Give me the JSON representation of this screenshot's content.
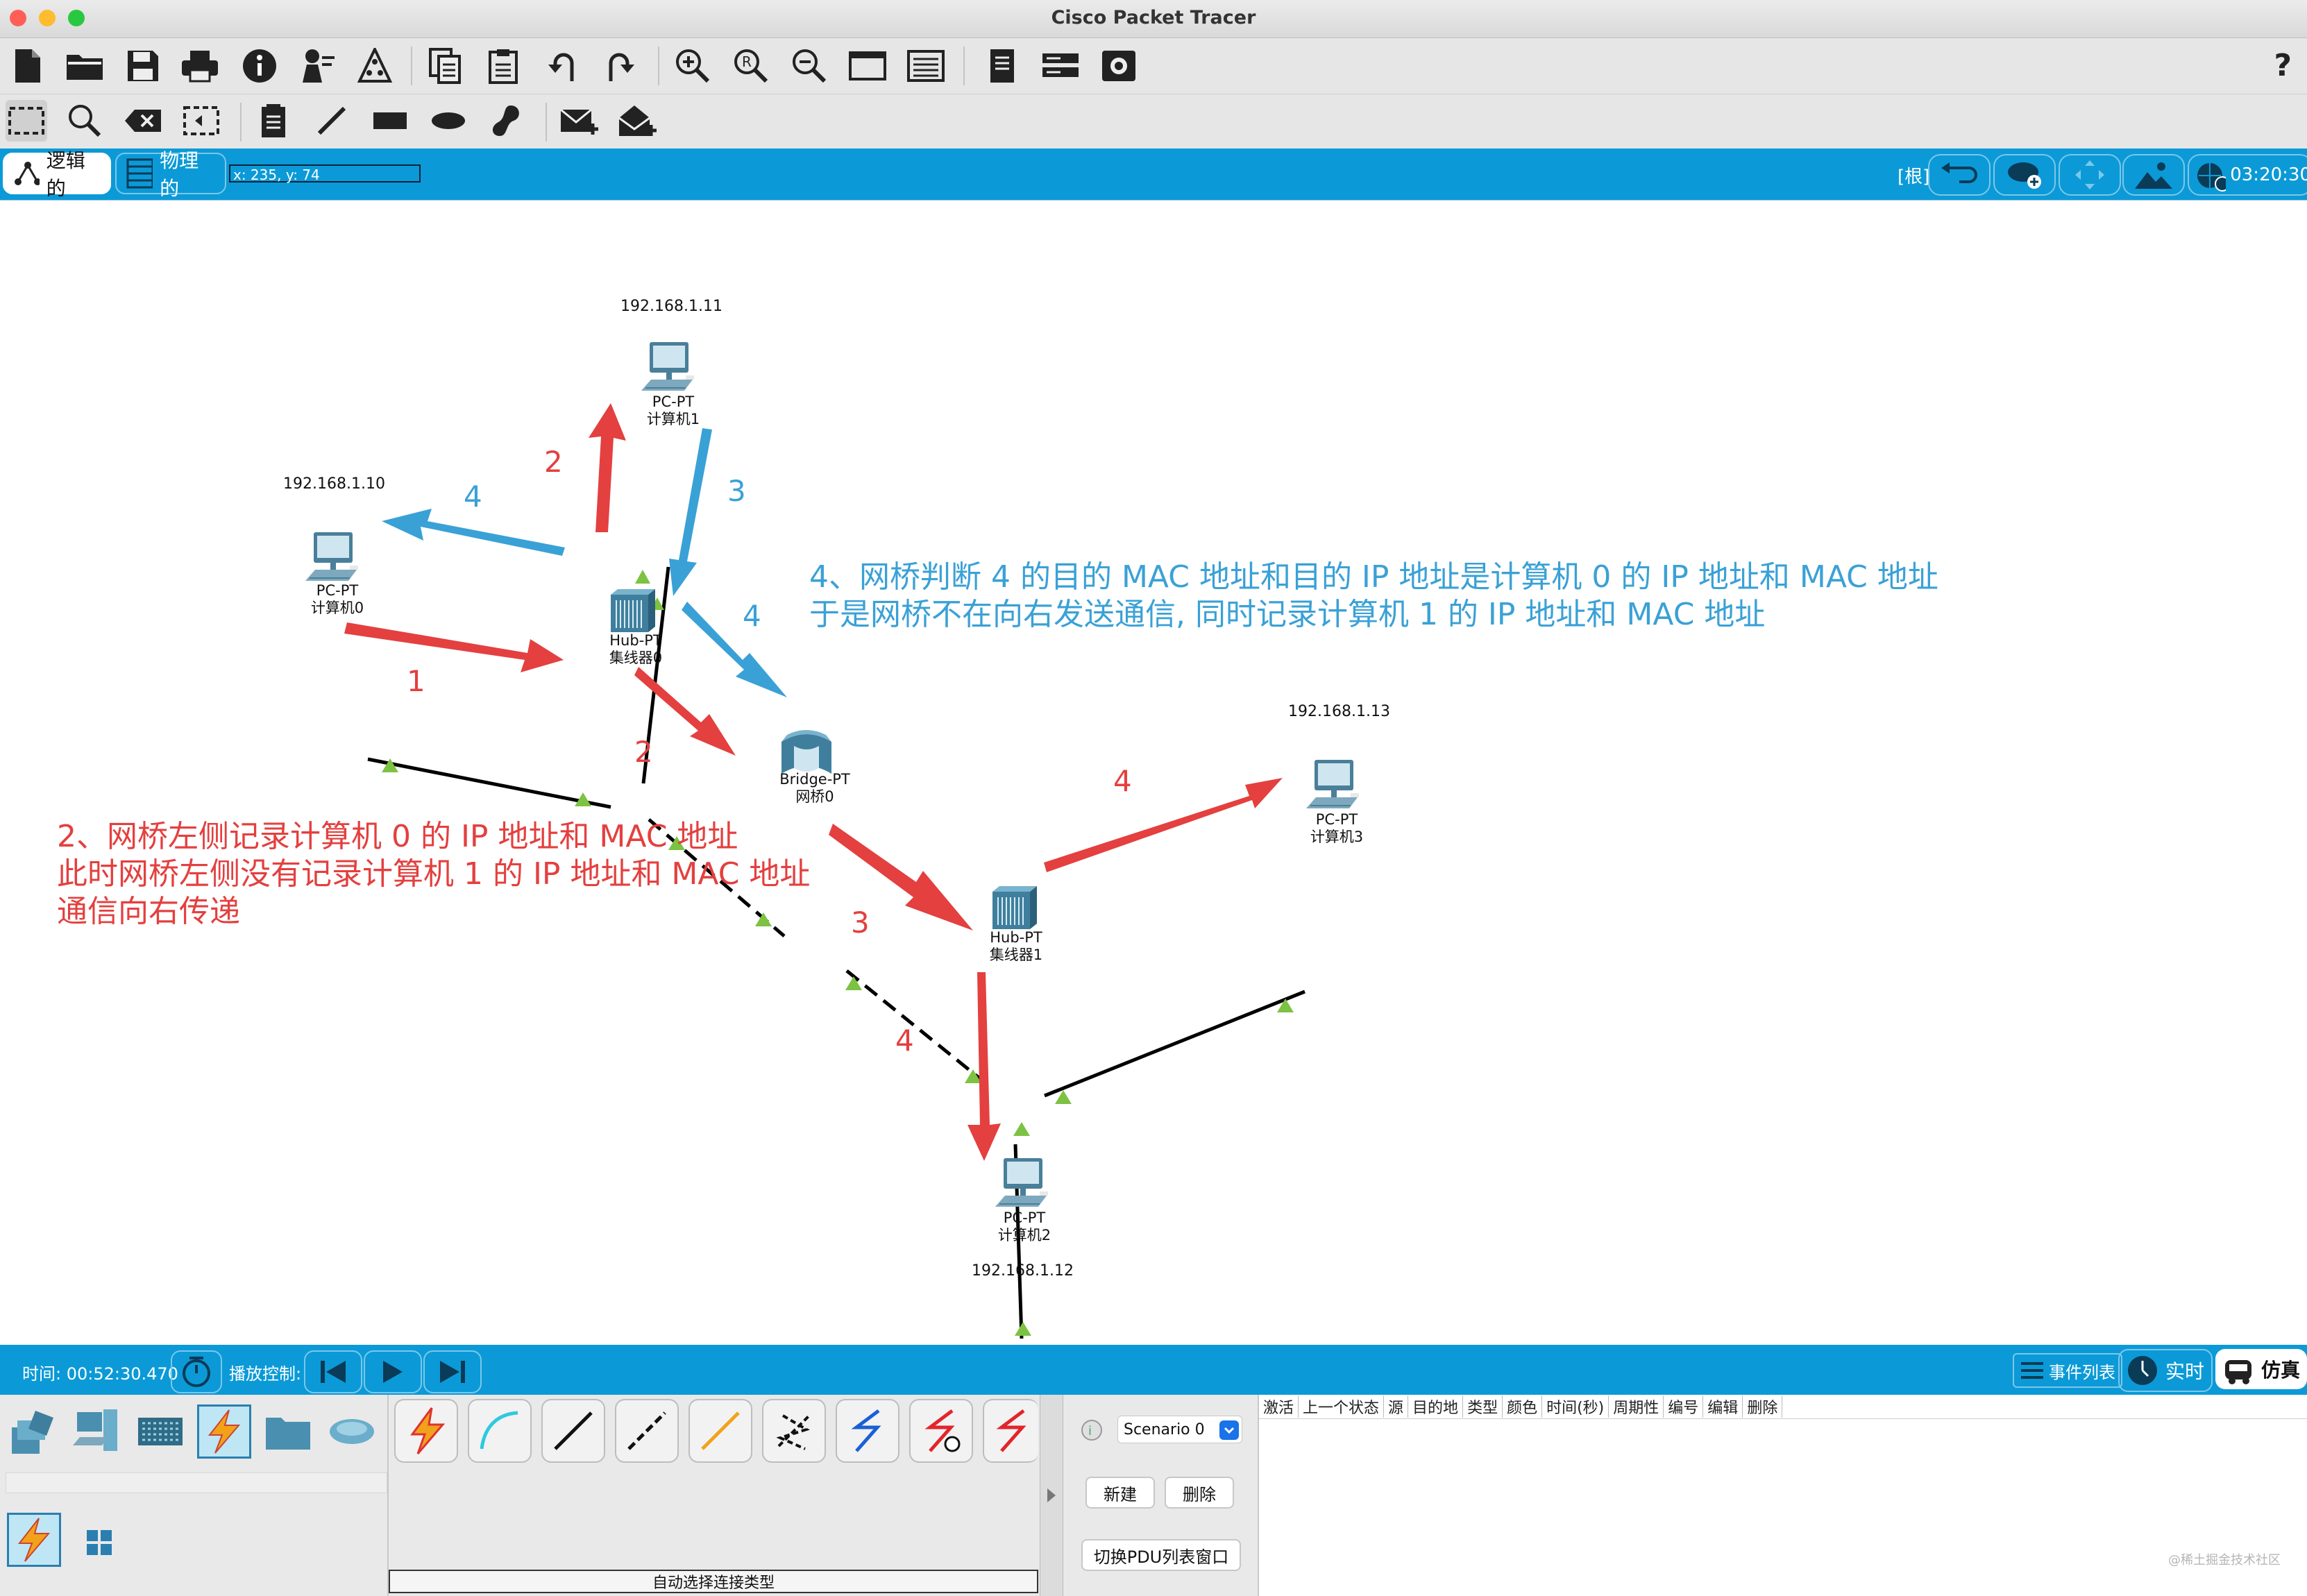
{
  "window": {
    "title": "Cisco Packet Tracer"
  },
  "toolbar_main": {
    "icons": [
      "new-file",
      "open-folder",
      "save",
      "print",
      "info",
      "activity-wizard",
      "network-info",
      "copy",
      "paste",
      "undo",
      "redo",
      "zoom-in",
      "zoom-reset",
      "zoom-out",
      "drawing-palette",
      "custom-device-dialog",
      "pdu-list",
      "cluster",
      "user-profile"
    ],
    "help": "?"
  },
  "toolbar_edit": {
    "icons": [
      "select",
      "inspect",
      "delete",
      "resize",
      "note",
      "draw-line",
      "rectangle",
      "ellipse",
      "freeform",
      "add-simple-pdu",
      "add-complex-pdu"
    ]
  },
  "workspace_bar": {
    "logical_tab": "逻辑的",
    "physical_tab": "物理的",
    "coords": "x: 235, y: 74",
    "root": "[根]",
    "clock": "03:20:30"
  },
  "topology": {
    "devices": [
      {
        "id": "pc1",
        "model": "PC-PT",
        "name": "计算机1",
        "ip": "192.168.1.11"
      },
      {
        "id": "pc0",
        "model": "PC-PT",
        "name": "计算机0",
        "ip": "192.168.1.10"
      },
      {
        "id": "hub0",
        "model": "Hub-PT",
        "name": "集线器0"
      },
      {
        "id": "bridge0",
        "model": "Bridge-PT",
        "name": "网桥0"
      },
      {
        "id": "hub1",
        "model": "Hub-PT",
        "name": "集线器1"
      },
      {
        "id": "pc3",
        "model": "PC-PT",
        "name": "计算机3",
        "ip": "192.168.1.13"
      },
      {
        "id": "pc2",
        "model": "PC-PT",
        "name": "计算机2",
        "ip": "192.168.1.12"
      }
    ],
    "arrow_numbers": [
      "2",
      "4",
      "3",
      "1",
      "4",
      "2",
      "4",
      "3",
      "4"
    ],
    "annotation_blue": [
      "4、网桥判断 4 的目的 MAC 地址和目的 IP 地址是计算机 0 的 IP 地址和 MAC 地址",
      "于是网桥不在向右发送通信, 同时记录计算机 1 的 IP 地址和 MAC 地址"
    ],
    "annotation_red": [
      "2、网桥左侧记录计算机 0 的 IP 地址和 MAC 地址",
      "此时网桥左侧没有记录计算机 1 的 IP 地址和 MAC 地址",
      "通信向右传递"
    ],
    "colors": {
      "red": "#e3403f",
      "blue": "#3aa1d6",
      "link_arrow": "#7dc242"
    }
  },
  "sim_bar": {
    "time_label": "时间: 00:52:30.470",
    "playback_label": "播放控制:",
    "event_list": "事件列表",
    "realtime": "实时",
    "simulation": "仿真"
  },
  "bottom_panel": {
    "connection_type_label": "自动选择连接类型",
    "scenario_select": "Scenario 0",
    "new_button": "新建",
    "delete_button": "删除",
    "toggle_pdu_button": "切换PDU列表窗口",
    "pdu_columns": [
      "激活",
      "上一个状态",
      "源",
      "目的地",
      "类型",
      "颜色",
      "时间(秒)",
      "周期性",
      "编号",
      "编辑",
      "删除"
    ],
    "watermark": "@稀土掘金技术社区"
  }
}
